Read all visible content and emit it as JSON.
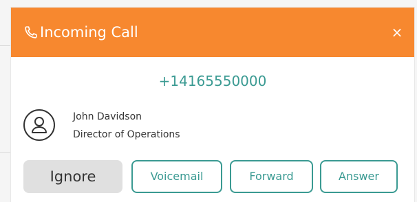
{
  "dialog": {
    "title": "Incoming Call",
    "close_label": "×",
    "icons": {
      "title_icon": "phone-icon",
      "avatar_icon": "user-icon"
    },
    "colors": {
      "header": "#f7882f",
      "accent": "#3a9a92",
      "ignore_bg": "#e0e0e0"
    }
  },
  "caller": {
    "number": "+14165550000",
    "name": "John Davidson",
    "title": "Director of Operations"
  },
  "actions": {
    "ignore_label": "Ignore",
    "voicemail_label": "Voicemail",
    "forward_label": "Forward",
    "answer_label": "Answer"
  }
}
